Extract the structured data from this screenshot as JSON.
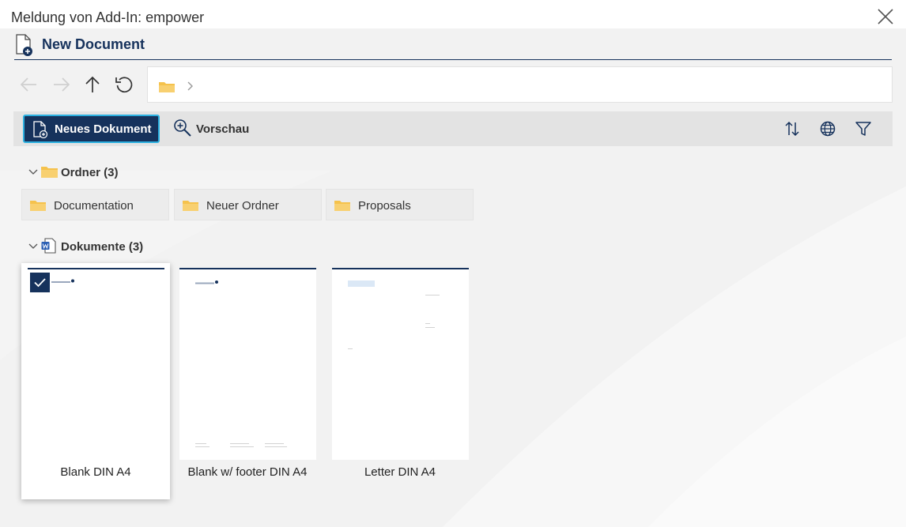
{
  "dialog": {
    "title": "Meldung von Add-In: empower"
  },
  "app": {
    "title": "New Document"
  },
  "toolbar": {
    "new_document_label": "Neues Dokument",
    "preview_label": "Vorschau"
  },
  "folders": {
    "header": "Ordner (3)",
    "items": [
      {
        "label": "Documentation"
      },
      {
        "label": "Neuer Ordner"
      },
      {
        "label": "Proposals"
      }
    ]
  },
  "documents": {
    "header": "Dokumente (3)",
    "items": [
      {
        "label": "Blank DIN A4",
        "selected": true
      },
      {
        "label": "Blank w/ footer DIN A4",
        "selected": false
      },
      {
        "label": "Letter DIN A4",
        "selected": false
      }
    ]
  },
  "colors": {
    "brand": "#16325c",
    "accent_border": "#2bb0e0",
    "folder": "#f5c24c",
    "toolbar_bg": "#e3e3e3",
    "panel_bg": "#f2f2f2"
  },
  "icons": {
    "close": "close-icon",
    "app": "new-document-icon",
    "back": "arrow-left-icon",
    "forward": "arrow-right-icon",
    "up": "arrow-up-icon",
    "refresh": "refresh-icon",
    "folder": "folder-icon",
    "sort": "sort-icon",
    "language": "globe-icon",
    "filter": "filter-icon",
    "word": "word-document-icon",
    "preview": "zoom-in-icon",
    "checkbox": "checkmark-icon"
  }
}
